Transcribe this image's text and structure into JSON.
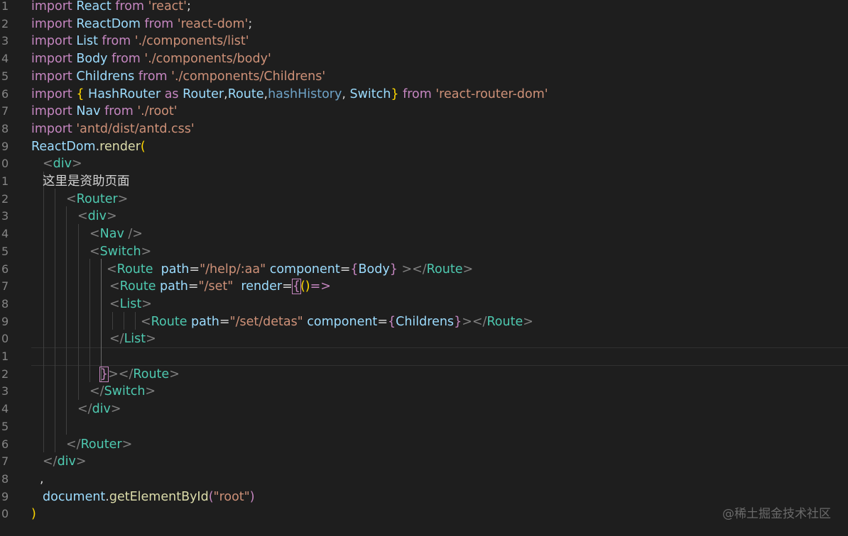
{
  "line_numbers": [
    "1",
    "2",
    "3",
    "4",
    "5",
    "6",
    "7",
    "8",
    "9",
    "0",
    "1",
    "2",
    "3",
    "4",
    "5",
    "6",
    "7",
    "8",
    "9",
    "0",
    "1",
    "2",
    "3",
    "4",
    "5",
    "6",
    "7",
    "8",
    "9",
    "0"
  ],
  "code": {
    "l1": {
      "kw1": "import",
      "id": " React ",
      "kw2": "from",
      "s": " 'react'",
      "p": ";"
    },
    "l2": {
      "kw1": "import",
      "id": " ReactDom ",
      "kw2": "from",
      "s": " 'react-dom'",
      "p": ";"
    },
    "l3": {
      "kw1": "import",
      "id": " List ",
      "kw2": "from",
      "s": " './components/list'"
    },
    "l4": {
      "kw1": "import",
      "id": " Body ",
      "kw2": "from",
      "s": " './components/body'"
    },
    "l5": {
      "kw1": "import",
      "id": " Childrens ",
      "kw2": "from",
      "s": " './components/Childrens'"
    },
    "l6": {
      "kw1": "import",
      "b1": " {",
      "id1": " HashRouter ",
      "kw_as": "as",
      "id2": " Router",
      "p1": ",",
      "id3": "Route",
      "p2": ",",
      "id4": "hashHistory",
      "p3": ",",
      "id5": " Switch",
      "b2": "}",
      "kw2": " from",
      "s": " 'react-router-dom'"
    },
    "l7": {
      "kw1": "import",
      "id": " Nav ",
      "kw2": "from",
      "s": " './root'"
    },
    "l8": {
      "kw1": "import",
      "s": " 'antd/dist/antd.css'"
    },
    "l9": {
      "id": "ReactDom",
      "p": ".",
      "fn": "render",
      "b": "("
    },
    "l10": {
      "lt": "<",
      "tag": "div",
      "gt": ">"
    },
    "l11": {
      "text": "这里是资助页面"
    },
    "l12": {
      "lt": "<",
      "tag": "Router",
      "gt": ">"
    },
    "l13": {
      "lt": "<",
      "tag": "div",
      "gt": ">"
    },
    "l14": {
      "lt": "<",
      "tag": "Nav",
      "gt": " />"
    },
    "l15": {
      "lt": "<",
      "tag": "Switch",
      "gt": ">"
    },
    "l16": {
      "lt": "<",
      "tag": "Route",
      "a1": "  path",
      "eq1": "=",
      "s1": "\"/help/:aa\"",
      "a2": " component",
      "eq2": "=",
      "b1": "{",
      "id": "Body",
      "b2": "}",
      "gt": " ></",
      "tag2": "Route",
      "gt2": ">"
    },
    "l17": {
      "lt": "<",
      "tag": "Route",
      "a1": " path",
      "eq1": "=",
      "s1": "\"/set\"",
      "a2": "  render",
      "eq2": "=",
      "b1": "{",
      "p": "()",
      "arrow": "=>"
    },
    "l18": {
      "lt": "<",
      "tag": "List",
      "gt": ">"
    },
    "l19": {
      "lt": "<",
      "tag": "Route",
      "a1": " path",
      "eq1": "=",
      "s1": "\"/set/detas\"",
      "a2": " component",
      "eq2": "=",
      "b1": "{",
      "id": "Childrens",
      "b2": "}",
      "gt": "></",
      "tag2": "Route",
      "gt2": ">"
    },
    "l20": {
      "lt": "</",
      "tag": "List",
      "gt": ">"
    },
    "l22": {
      "b": "}",
      "gt": "></",
      "tag": "Route",
      "gt2": ">"
    },
    "l23": {
      "lt": "</",
      "tag": "Switch",
      "gt": ">"
    },
    "l24": {
      "lt": "</",
      "tag": "div",
      "gt": ">"
    },
    "l26": {
      "lt": "</",
      "tag": "Router",
      "gt": ">"
    },
    "l27": {
      "lt": "</",
      "tag": "div",
      "gt": ">"
    },
    "l28": {
      "p": ","
    },
    "l29": {
      "id": "document",
      "p": ".",
      "fn": "getElementById",
      "b1": "(",
      "s": "\"root\"",
      "b2": ")"
    },
    "l30": {
      "b": ")"
    }
  },
  "watermark": "@稀土掘金技术社区"
}
